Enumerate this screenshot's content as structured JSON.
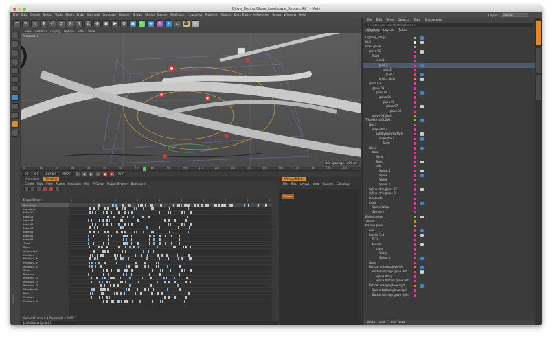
{
  "window": {
    "title": "Glove_Boxing/Glove_Landscape_Rebus.c4d * - Main"
  },
  "menubar": [
    "File",
    "Edit",
    "Create",
    "Select",
    "Tools",
    "Mesh",
    "Snap",
    "Animate",
    "Simulate",
    "Render",
    "Sculpt",
    "Motion Tracker",
    "MoGraph",
    "Character",
    "Pipeline",
    "Plugins",
    "Dark Earth",
    "X-Particles",
    "Script",
    "Window",
    "Help"
  ],
  "layout": {
    "label": "Layout:",
    "value": "Startup"
  },
  "toolbar_icons": [
    "undo-icon",
    "redo-icon",
    "select-icon",
    "move-icon",
    "scale-icon",
    "rotate-icon",
    "x-axis-icon",
    "y-axis-icon",
    "z-axis-icon",
    "coord-icon",
    "render-view-icon",
    "render-icon",
    "render-settings-icon",
    "cube-icon",
    "pen-icon",
    "subdivision-icon",
    "array-icon",
    "deformer-icon",
    "floor-icon",
    "camera-icon",
    "light-icon"
  ],
  "toolbar_glyphs": [
    "↶",
    "↷",
    "↖",
    "✥",
    "⤢",
    "⟳",
    "X",
    "Y",
    "Z",
    "⊕",
    "▣",
    "▶",
    "⚙",
    "◼",
    "✎",
    "◈",
    "⁂",
    "✦",
    "▭",
    "🎥",
    "☀"
  ],
  "viewport": {
    "menu": [
      "View",
      "Cameras",
      "Display",
      "Options",
      "Filter",
      "Panel"
    ],
    "label": "Perspective",
    "status": "Grid Spacing : 1000 cm"
  },
  "timeline": {
    "ticks": [
      "0",
      "10",
      "20",
      "30",
      "40",
      "50",
      "60",
      "70",
      "80",
      "90",
      "100",
      "110",
      "120",
      "130",
      "140",
      "150",
      "160",
      "170",
      "180",
      "190",
      "200"
    ],
    "frame_end": "200 F",
    "fields": [
      "0 F",
      "0 F",
      "4267.6 F",
      "9597 F"
    ],
    "playhead_value": 75,
    "current_frame": "75 F"
  },
  "anim_panel": {
    "tabs": [
      "Animation",
      "Timeline"
    ],
    "active_tab": "Timeline",
    "menu": [
      "Create",
      "Edit",
      "View",
      "Frame",
      "Functions",
      "Key",
      "F-Curve",
      "Motion System",
      "Bookmarks"
    ],
    "title": "Dope Sheet",
    "ruler": [
      "0",
      "1",
      "2",
      "3",
      "4",
      "5",
      "6",
      "7",
      "8",
      "9"
    ],
    "tracks": [
      "Summary",
      "top glove",
      "tube 10",
      "tube 11",
      "tube 12",
      "tube 13",
      "tube 14",
      "tube 01",
      "tube 02",
      "tube 03",
      "Twist",
      "Bend",
      "ellipsetto.1",
      "Position",
      "Position . X",
      "Position . Y",
      "Position . Z",
      "Scale",
      "Rotation",
      "Rotation . H",
      "Rotation . P",
      "Rotation . B",
      "Face Morph",
      "Bow",
      "Position",
      "Position . X"
    ],
    "status_current": "Current Frame  0.5  Preview  0-->9.997",
    "status_bottom": "Joint Object [joint.2]"
  },
  "xpresso": {
    "tab": "XPresso Editor",
    "menu": [
      "File",
      "Edit",
      "Layout",
      "View",
      "Custom",
      "Calculate"
    ],
    "node": "XGroup"
  },
  "objects_panel": {
    "menu": [
      "File",
      "Edit",
      "View",
      "Objects",
      "Tags",
      "Bookmarks"
    ],
    "search_placeholder": "<<Enter your search string here>>",
    "tabs": [
      "Objects",
      "Layers",
      "Takes"
    ],
    "items": [
      {
        "name": "Lighting_Stage",
        "indent": 0,
        "color": "#6ad26a"
      },
      {
        "name": "Null",
        "indent": 0,
        "color": "#f1f1f1"
      },
      {
        "name": "main glove",
        "indent": 0,
        "color": "#6ad26a"
      },
      {
        "name": "glove 01",
        "indent": 1,
        "color": "#e23aa0"
      },
      {
        "name": "Root",
        "indent": 2,
        "color": "#e23aa0"
      },
      {
        "name": "Joint.1",
        "indent": 3,
        "color": "#e23aa0"
      },
      {
        "name": "Joint.2",
        "indent": 4,
        "color": "#e23aa0"
      },
      {
        "name": "Joint.3",
        "indent": 5,
        "color": "#e23aa0"
      },
      {
        "name": "Joint.4",
        "indent": 6,
        "color": "#e23aa0"
      },
      {
        "name": "Joint.4.Goal",
        "indent": 4,
        "color": "#e08a27"
      },
      {
        "name": "glove 02",
        "indent": 1,
        "color": "#e23aa0"
      },
      {
        "name": "glove 03",
        "indent": 2,
        "color": "#e23aa0"
      },
      {
        "name": "glove 04",
        "indent": 3,
        "color": "#e23aa0"
      },
      {
        "name": "glove 05",
        "indent": 4,
        "color": "#e23aa0"
      },
      {
        "name": "glove 06",
        "indent": 5,
        "color": "#e23aa0"
      },
      {
        "name": "glove 07",
        "indent": 6,
        "color": "#e23aa0"
      },
      {
        "name": "glove 08",
        "indent": 7,
        "color": "#e23aa0"
      },
      {
        "name": "glove 09.Goal",
        "indent": 2,
        "color": "#e08a27"
      },
      {
        "name": "TRAINER & GLOVE",
        "indent": 0,
        "color": "#6ad26a"
      },
      {
        "name": "Null.1",
        "indent": 1,
        "color": "#e23aa0"
      },
      {
        "name": "ellipsetto.1",
        "indent": 2,
        "color": "#e23aa0"
      },
      {
        "name": "Subdivision Surface",
        "indent": 3,
        "color": "#e23aa0"
      },
      {
        "name": "ellipsetto.1",
        "indent": 4,
        "color": "#e23aa0"
      },
      {
        "name": "Twist",
        "indent": 5,
        "color": "#e23aa0"
      },
      {
        "name": "Null.2",
        "indent": 1,
        "color": "#e23aa0"
      },
      {
        "name": "bow",
        "indent": 2,
        "color": "#e23aa0"
      },
      {
        "name": "Bend",
        "indent": 3,
        "color": "#e23aa0"
      },
      {
        "name": "Twist",
        "indent": 3,
        "color": "#e23aa0"
      },
      {
        "name": "Loft",
        "indent": 3,
        "color": "#e23aa0"
      },
      {
        "name": "Spline.2",
        "indent": 4,
        "color": "#e23aa0"
      },
      {
        "name": "Spline",
        "indent": 4,
        "color": "#e23aa0"
      },
      {
        "name": "Spline",
        "indent": 4,
        "color": "#e23aa0"
      },
      {
        "name": "Spline.1",
        "indent": 4,
        "color": "#e23aa0"
      },
      {
        "name": "Spline strip glove 02",
        "indent": 1,
        "color": "#e23aa0"
      },
      {
        "name": "Spline strip glove 01",
        "indent": 1,
        "color": "#e23aa0"
      },
      {
        "name": "langouste",
        "indent": 1,
        "color": "#e23aa0"
      },
      {
        "name": "Cubic",
        "indent": 1,
        "color": "#e23aa0"
      },
      {
        "name": "Spline Wrap",
        "indent": 2,
        "color": "#e23aa0"
      },
      {
        "name": "Symetry",
        "indent": 2,
        "color": "#e23aa0"
      },
      {
        "name": "Bottom shoe",
        "indent": 0,
        "color": "#6ad26a"
      },
      {
        "name": "Trainer",
        "indent": 0,
        "color": "#e08a27"
      },
      {
        "name": "Boxing glove",
        "indent": 0,
        "color": "#e08a27"
      },
      {
        "name": "edit",
        "indent": 1,
        "color": "#e23aa0"
      },
      {
        "name": "Lacets End",
        "indent": 1,
        "color": "#e23aa0"
      },
      {
        "name": "FFD",
        "indent": 2,
        "color": "#e23aa0"
      },
      {
        "name": "Lacets",
        "indent": 2,
        "color": "#e23aa0"
      },
      {
        "name": "lunes",
        "indent": 3,
        "color": "#e23aa0"
      },
      {
        "name": "Circle",
        "indent": 4,
        "color": "#e23aa0"
      },
      {
        "name": "Spline.2",
        "indent": 4,
        "color": "#e23aa0"
      },
      {
        "name": "tubes",
        "indent": 1,
        "color": "#e23aa0"
      },
      {
        "name": "Bottom orange glove left",
        "indent": 1,
        "color": "#e08a27"
      },
      {
        "name": "Bottom orange glove left",
        "indent": 2,
        "color": "#e23aa0"
      },
      {
        "name": "Spline Wrap",
        "indent": 3,
        "color": "#e23aa0"
      },
      {
        "name": "Spline bottom glove left",
        "indent": 3,
        "color": "#e23aa0"
      },
      {
        "name": "Bottom orange glove right",
        "indent": 1,
        "color": "#e08a27"
      },
      {
        "name": "Spline bottom glove right",
        "indent": 2,
        "color": "#e23aa0"
      },
      {
        "name": "Bottom orange glove right",
        "indent": 2,
        "color": "#e23aa0"
      }
    ],
    "bottom_menu": [
      "Mode",
      "Edit",
      "User Data"
    ]
  },
  "colors": {
    "accent": "#e08a27",
    "green": "#6ad26a",
    "magenta": "#e23aa0",
    "playhead": "#43d16b"
  }
}
